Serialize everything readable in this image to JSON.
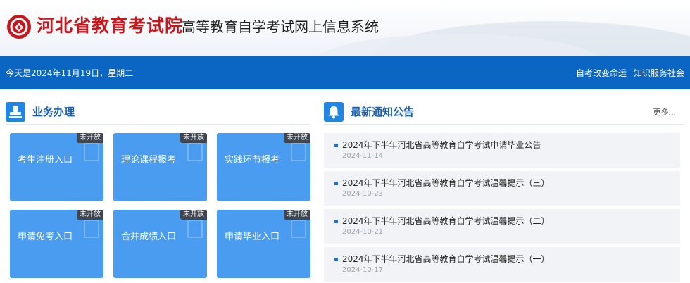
{
  "header": {
    "org_title": "河北省教育考试院",
    "system_title": "高等教育自学考试网上信息系统"
  },
  "topbar": {
    "date_text": "今天是2024年11月19日，星期二",
    "links": [
      "自考改变命运",
      "知识服务社会"
    ]
  },
  "business": {
    "title": "业务办理",
    "icon": "seal-stamp-icon",
    "tiles": [
      {
        "label": "考生注册入口",
        "badge": "未开放"
      },
      {
        "label": "理论课程报考",
        "badge": "未开放"
      },
      {
        "label": "实践环节报考",
        "badge": "未开放"
      },
      {
        "label": "申请免考入口",
        "badge": "未开放"
      },
      {
        "label": "合并成绩入口",
        "badge": "未开放"
      },
      {
        "label": "申请毕业入口",
        "badge": "未开放"
      }
    ]
  },
  "notices": {
    "title": "最新通知公告",
    "icon": "bell-icon",
    "more_label": "更多...",
    "items": [
      {
        "title": "2024年下半年河北省高等教育自学考试申请毕业公告",
        "date": "2024-11-14"
      },
      {
        "title": "2024年下半年河北省高等教育自学考试温馨提示（三）",
        "date": "2024-10-23"
      },
      {
        "title": "2024年下半年河北省高等教育自学考试温馨提示（二）",
        "date": "2024-10-21"
      },
      {
        "title": "2024年下半年河北省高等教育自学考试温馨提示（一）",
        "date": "2024-10-17"
      }
    ]
  },
  "colors": {
    "brand_red": "#c8161d",
    "bar_blue": "#0b66c3",
    "tile_blue": "#4a9cf1",
    "badge_dark": "#3f4650"
  }
}
